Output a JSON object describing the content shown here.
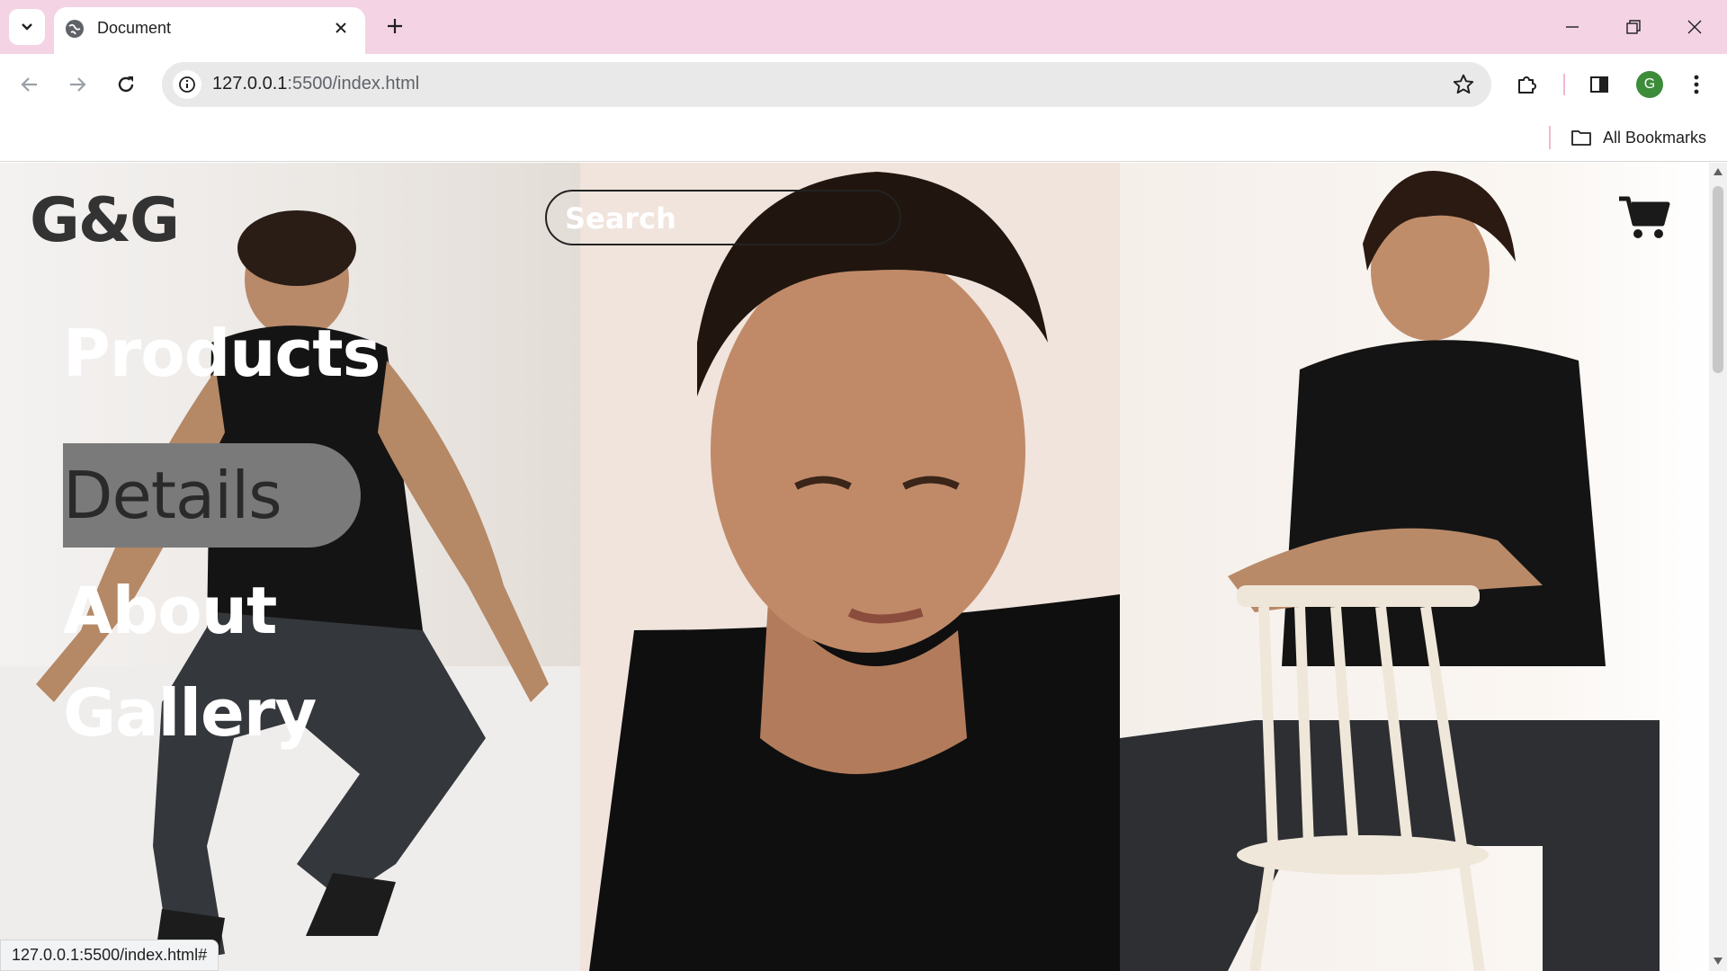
{
  "browser": {
    "tab_title": "Document",
    "url_host": "127.0.0.1",
    "url_rest": ":5500/index.html",
    "bookmarks_label": "All Bookmarks",
    "profile_initial": "G",
    "status_url": "127.0.0.1:5500/index.html#",
    "colors": {
      "frame": "#f3d3e4",
      "profile": "#3c8c3a"
    },
    "icons": [
      "tab-search-icon",
      "globe-icon",
      "close-icon",
      "plus-icon",
      "minimize-icon",
      "restore-icon",
      "window-close-icon",
      "back-icon",
      "forward-icon",
      "reload-icon",
      "info-icon",
      "star-icon",
      "extensions-icon",
      "side-panel-icon",
      "kebab-menu-icon",
      "folder-icon"
    ]
  },
  "site": {
    "logo": "G&G",
    "search_placeholder": "Search",
    "cart_icon": "cart-icon",
    "menu": [
      {
        "label": "Products",
        "active": false
      },
      {
        "label": "Details",
        "active": true
      },
      {
        "label": "About",
        "active": false
      },
      {
        "label": "Gallery",
        "active": false
      }
    ]
  }
}
